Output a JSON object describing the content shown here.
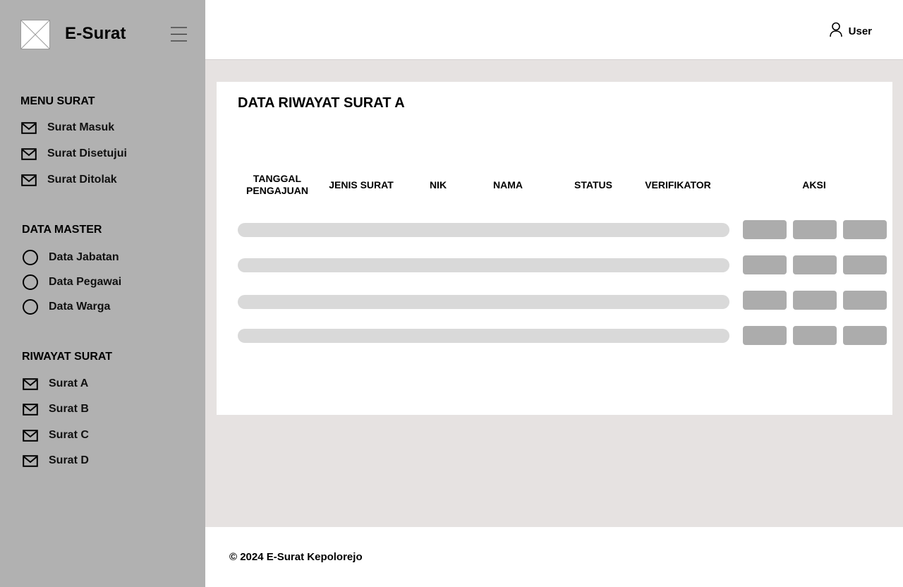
{
  "app": {
    "name": "E-Surat"
  },
  "sidebar": {
    "menu_surat": {
      "title": "MENU SURAT",
      "items": [
        {
          "label": "Surat Masuk",
          "icon": "mail-icon"
        },
        {
          "label": "Surat Disetujui",
          "icon": "mail-icon"
        },
        {
          "label": "Surat Ditolak",
          "icon": "mail-icon"
        }
      ]
    },
    "data_master": {
      "title": "DATA MASTER",
      "items": [
        {
          "label": "Data Jabatan",
          "icon": "circle-icon"
        },
        {
          "label": "Data Pegawai",
          "icon": "circle-icon"
        },
        {
          "label": "Data Warga",
          "icon": "circle-icon"
        }
      ]
    },
    "riwayat_surat": {
      "title": "RIWAYAT SURAT",
      "items": [
        {
          "label": "Surat A",
          "icon": "mail-icon"
        },
        {
          "label": "Surat B",
          "icon": "mail-icon"
        },
        {
          "label": "Surat C",
          "icon": "mail-icon"
        },
        {
          "label": "Surat D",
          "icon": "mail-icon"
        }
      ]
    }
  },
  "topbar": {
    "user_label": "User",
    "user_icon": "user-icon"
  },
  "main": {
    "title": "DATA RIWAYAT SURAT A",
    "table": {
      "columns": {
        "tanggal_line1": "TANGGAL",
        "tanggal_line2": "PENGAJUAN",
        "jenis": "JENIS SURAT",
        "nik": "NIK",
        "nama": "NAMA",
        "status": "STATUS",
        "verifikator": "VERIFIKATOR",
        "aksi": "AKSI"
      },
      "row_count": 4
    }
  },
  "footer": {
    "text": "© 2024 E-Surat Kepolorejo"
  },
  "colors": {
    "sidebar_bg": "#b1b1b1",
    "content_bg": "#e6e2e1",
    "placeholder_bar": "#d9d9d9",
    "action_button": "#acacac"
  }
}
